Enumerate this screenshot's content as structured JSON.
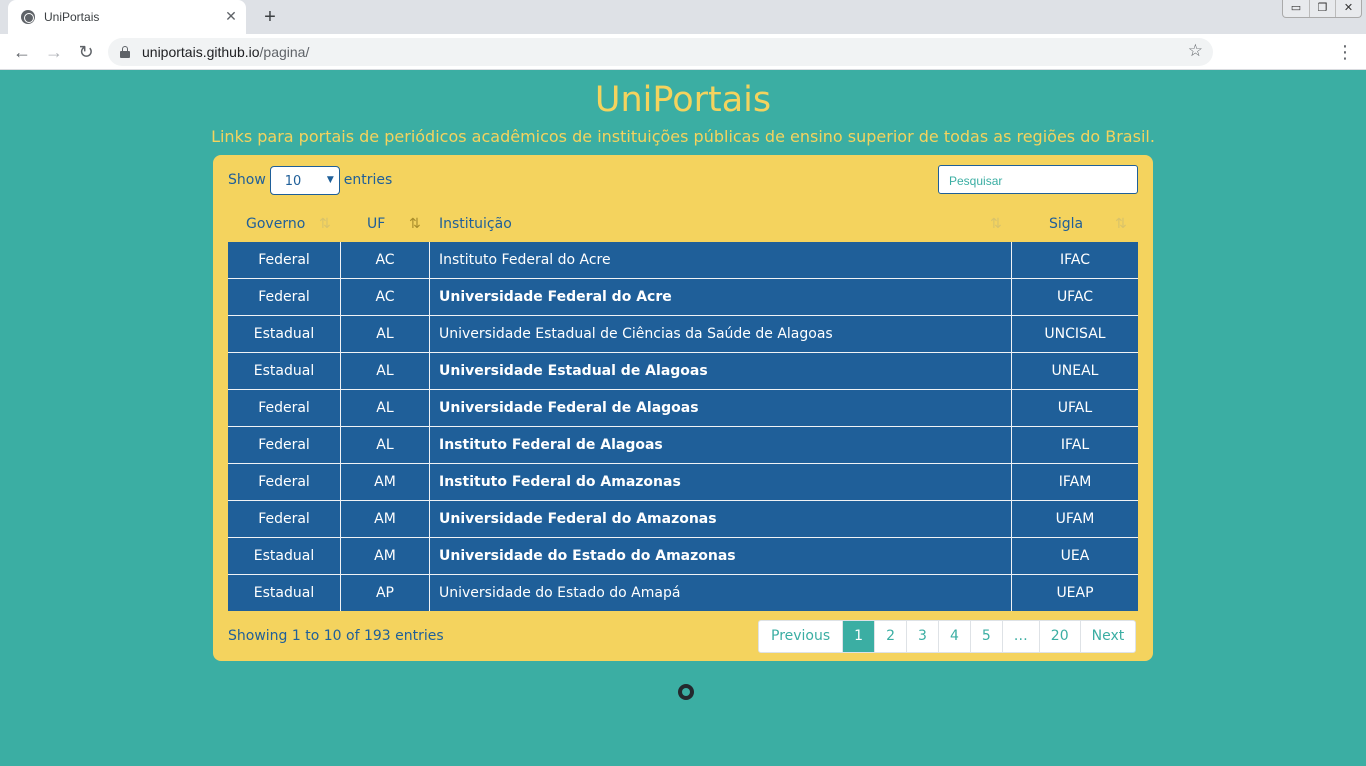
{
  "browser": {
    "tab_title": "UniPortais",
    "tab_close": "✕",
    "new_tab": "+",
    "url_host": "uniportais.github.io",
    "url_path": "/pagina/",
    "back": "←",
    "forward": "→",
    "reload": "↻",
    "star": "☆",
    "menu": "⋮",
    "win_min": "▭",
    "win_restore": "❐",
    "win_close": "✕"
  },
  "page": {
    "title": "UniPortais",
    "subtitle": "Links para portais de periódicos acadêmicos de instituições públicas de ensino superior de todas as regiões do Brasil."
  },
  "controls": {
    "show_label": "Show",
    "entries_label": "entries",
    "length_value": "10",
    "search_placeholder": "Pesquisar"
  },
  "table": {
    "headers": [
      "Governo",
      "UF",
      "Instituição",
      "Sigla"
    ],
    "sorted_column": "UF",
    "rows": [
      {
        "governo": "Federal",
        "uf": "AC",
        "instituicao": "Instituto Federal do Acre",
        "sigla": "IFAC",
        "bold": false
      },
      {
        "governo": "Federal",
        "uf": "AC",
        "instituicao": "Universidade Federal do Acre",
        "sigla": "UFAC",
        "bold": true
      },
      {
        "governo": "Estadual",
        "uf": "AL",
        "instituicao": "Universidade Estadual de Ciências da Saúde de Alagoas",
        "sigla": "UNCISAL",
        "bold": false
      },
      {
        "governo": "Estadual",
        "uf": "AL",
        "instituicao": "Universidade Estadual de Alagoas",
        "sigla": "UNEAL",
        "bold": true
      },
      {
        "governo": "Federal",
        "uf": "AL",
        "instituicao": "Universidade Federal de Alagoas",
        "sigla": "UFAL",
        "bold": true
      },
      {
        "governo": "Federal",
        "uf": "AL",
        "instituicao": "Instituto Federal de Alagoas",
        "sigla": "IFAL",
        "bold": true
      },
      {
        "governo": "Federal",
        "uf": "AM",
        "instituicao": "Instituto Federal do Amazonas",
        "sigla": "IFAM",
        "bold": true
      },
      {
        "governo": "Federal",
        "uf": "AM",
        "instituicao": "Universidade Federal do Amazonas",
        "sigla": "UFAM",
        "bold": true
      },
      {
        "governo": "Estadual",
        "uf": "AM",
        "instituicao": "Universidade do Estado do Amazonas",
        "sigla": "UEA",
        "bold": true
      },
      {
        "governo": "Estadual",
        "uf": "AP",
        "instituicao": "Universidade do Estado do Amapá",
        "sigla": "UEAP",
        "bold": false
      }
    ]
  },
  "footer": {
    "info": "Showing 1 to 10 of 193 entries",
    "pagination": [
      "Previous",
      "1",
      "2",
      "3",
      "4",
      "5",
      "…",
      "20",
      "Next"
    ],
    "active_page": "1"
  },
  "colors": {
    "background": "#3baea3",
    "accent_yellow": "#f4d35e",
    "row_blue": "#1f5f99"
  },
  "icons": [
    "globe-icon",
    "lock-icon",
    "star-icon",
    "sort-icon",
    "github-icon"
  ]
}
